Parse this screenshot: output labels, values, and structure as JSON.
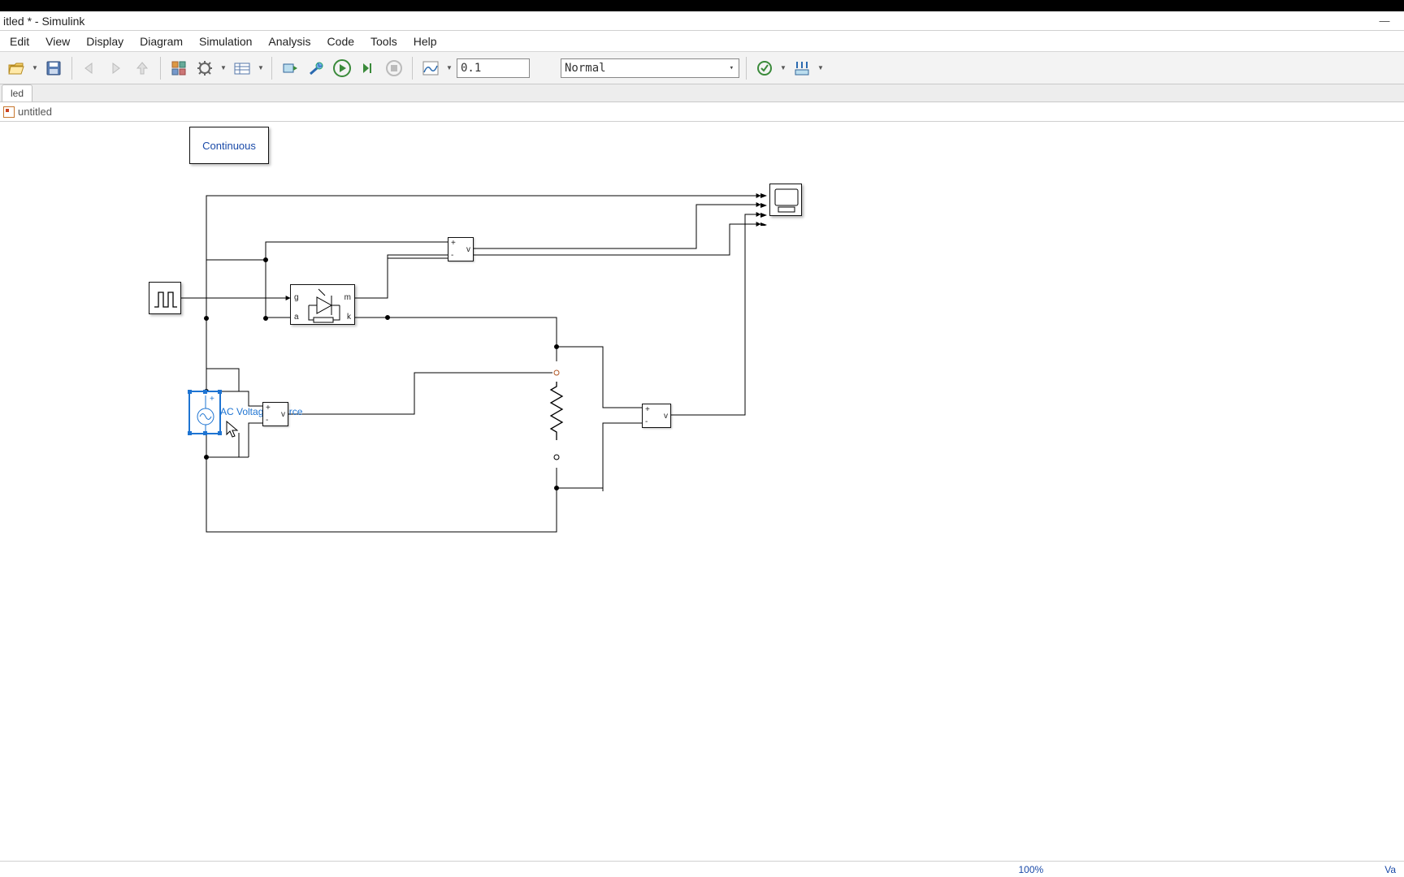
{
  "window": {
    "title": "itled * - Simulink",
    "minimize": "—"
  },
  "menu": {
    "edit": "Edit",
    "view": "View",
    "display": "Display",
    "diagram": "Diagram",
    "simulation": "Simulation",
    "analysis": "Analysis",
    "code": "Code",
    "tools": "Tools",
    "help": "Help"
  },
  "toolbar": {
    "stop_time": "0.1",
    "mode": "Normal"
  },
  "tabs": {
    "name": "led"
  },
  "breadcrumb": {
    "name": "untitled"
  },
  "blocks": {
    "powergui": {
      "label": "Continuous"
    },
    "ac_source": {
      "label": "AC Voltage Source"
    },
    "vm1": {
      "plus": "+",
      "minus": "-",
      "v": "v"
    },
    "vm2": {
      "plus": "+",
      "minus": "-",
      "v": "v"
    },
    "vm3": {
      "plus": "+",
      "minus": "-",
      "v": "v"
    },
    "thyristor": {
      "g": "g",
      "a": "a",
      "m": "m",
      "k": "k"
    }
  },
  "status": {
    "zoom": "100%",
    "right": "Va"
  }
}
